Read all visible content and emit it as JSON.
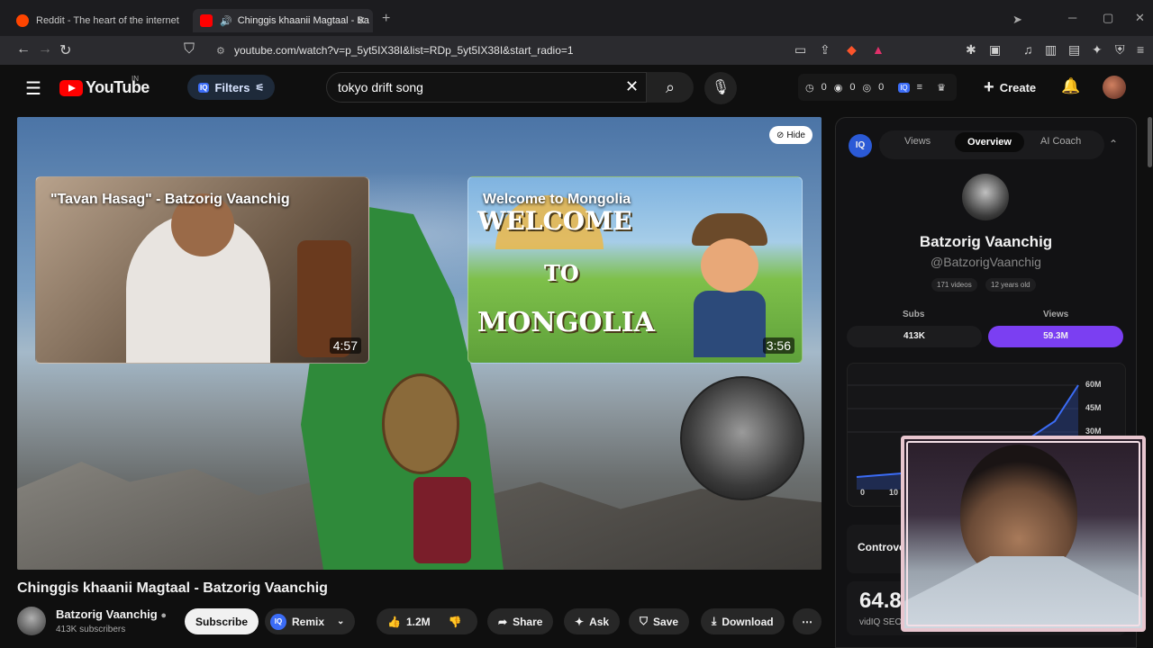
{
  "browser": {
    "tabs": [
      {
        "title": "Reddit - The heart of the internet"
      },
      {
        "title": "Chinggis khaanii Magtaal - Ba"
      }
    ],
    "url": "youtube.com/watch?v=p_5yt5IX38I&list=RDp_5yt5IX38I&start_radio=1"
  },
  "yt_header": {
    "logo_text": "YouTube",
    "country": "IN",
    "filters_label": "Filters",
    "search_value": "tokyo drift song",
    "stats": [
      "0",
      "0",
      "0"
    ],
    "create_label": "Create"
  },
  "player": {
    "hide_label": "Hide",
    "end_cards": [
      {
        "title": "\"Tavan Hasag\" - Batzorig Vaanchig",
        "duration": "4:57"
      },
      {
        "title": "Welcome to Mongolia",
        "duration": "3:56",
        "art_lines": [
          "WELCOME",
          "TO",
          "MONGOLIA"
        ]
      }
    ]
  },
  "video": {
    "title": "Chinggis khaanii Magtaal - Batzorig Vaanchig",
    "channel": "Batzorig Vaanchig",
    "subscribers": "413K subscribers",
    "subscribe_label": "Subscribe",
    "remix_label": "Remix",
    "likes": "1.2M",
    "share_label": "Share",
    "ask_label": "Ask",
    "save_label": "Save",
    "download_label": "Download"
  },
  "vidiq": {
    "badge": "IQ",
    "tabs": [
      "Views",
      "Overview",
      "AI Coach"
    ],
    "active_tab": "Overview",
    "channel_name": "Batzorig Vaanchig",
    "handle": "@BatzorigVaanchig",
    "video_count": "171 videos",
    "age": "12 years old",
    "subs_label": "Subs",
    "subs_value": "413K",
    "views_label": "Views",
    "views_value": "59.3M",
    "chart_y_ticks": [
      "60M",
      "45M",
      "30M"
    ],
    "chart_x_ticks": [
      "0",
      "10"
    ],
    "controversy_label": "Controve",
    "score_value": "64.8",
    "score_label": "vidIQ SEO"
  },
  "colors": {
    "accent_purple": "#7b3ff2",
    "yt_red": "#ff0000",
    "chart_line": "#3b6cf6"
  }
}
